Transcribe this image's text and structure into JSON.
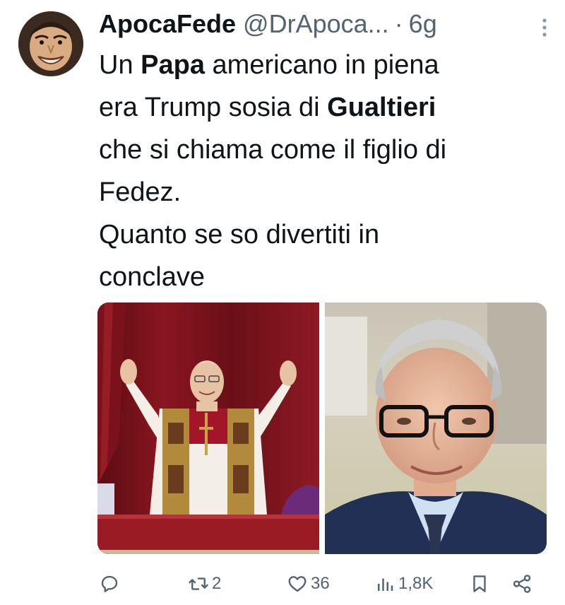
{
  "tweet": {
    "display_name": "ApocaFede",
    "handle": "@DrApoca...",
    "separator": "·",
    "time": "6g",
    "text": {
      "line1_pre": "Un ",
      "line1_bold": "Papa",
      "line1_post": " americano in piena",
      "line2_pre": "era Trump sosia di ",
      "line2_bold": "Gualtieri",
      "line3": "che si chiama come il figlio di",
      "line4": "Fedez.",
      "line5": "Quanto se so divertiti in",
      "line6": "conclave"
    }
  },
  "actions": {
    "reply_icon": "reply-icon",
    "retweet_count": "2",
    "like_count": "36",
    "views_count": "1,8K",
    "bookmark_icon": "bookmark-icon",
    "share_icon": "share-icon"
  },
  "colors": {
    "text_primary": "#0f1419",
    "text_secondary": "#536471"
  }
}
